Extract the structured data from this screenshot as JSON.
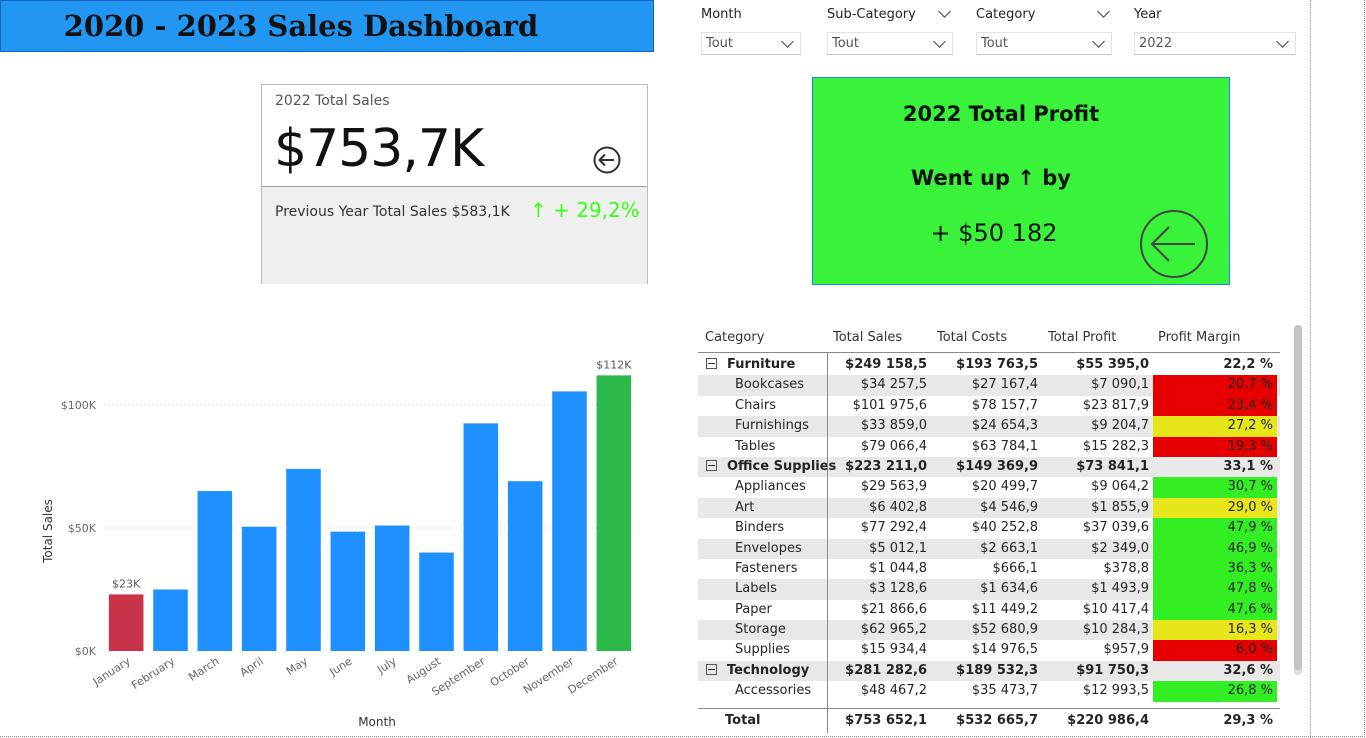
{
  "header": {
    "title": "2020 - 2023 Sales Dashboard"
  },
  "slicers": [
    {
      "label": "Month",
      "value": "Tout",
      "has_label_chevron": false
    },
    {
      "label": "Sub-Category",
      "value": "Tout",
      "has_label_chevron": true
    },
    {
      "label": "Category",
      "value": "Tout",
      "has_label_chevron": true
    },
    {
      "label": "Year",
      "value": "2022",
      "has_label_chevron": false
    }
  ],
  "sales_card": {
    "title": "2022 Total Sales",
    "value": "$753,7K",
    "previous": "Previous Year Total Sales $583,1K",
    "change": "↑ + 29,2%",
    "icon": "back-arrow-circle-icon"
  },
  "profit_card": {
    "title": "2022 Total Profit",
    "line2": "Went up ↑ by",
    "amount": "+ $50 182",
    "icon": "back-arrow-circle-icon",
    "bg_color": "#38f33a"
  },
  "chart_data": {
    "type": "bar",
    "title": "",
    "xlabel": "Month",
    "ylabel": "Total Sales",
    "categories": [
      "January",
      "February",
      "March",
      "April",
      "May",
      "June",
      "July",
      "August",
      "September",
      "October",
      "November",
      "December"
    ],
    "values": [
      23000,
      25000,
      65000,
      50500,
      74000,
      48500,
      51000,
      40000,
      92500,
      69000,
      105500,
      112000
    ],
    "ylim": [
      0,
      115000
    ],
    "yticks": [
      {
        "v": 0,
        "label": "$0K"
      },
      {
        "v": 50000,
        "label": "$50K"
      },
      {
        "v": 100000,
        "label": "$100K"
      }
    ],
    "data_labels": [
      {
        "index": 0,
        "label": "$23K"
      },
      {
        "index": 11,
        "label": "$112K"
      }
    ],
    "colors": {
      "default": "#1e90ff",
      "min": "#c8334a",
      "max": "#2db84a"
    },
    "grid": "horizontal dotted"
  },
  "matrix": {
    "columns": [
      "Category",
      "Total Sales",
      "Total Costs",
      "Total Profit",
      "Profit Margin"
    ],
    "rows": [
      {
        "type": "group",
        "cat": "Furniture",
        "sales": "$249 158,5",
        "costs": "$193 763,5",
        "profit": "$55 395,0",
        "margin": "22,2 %",
        "color": ""
      },
      {
        "type": "item",
        "cat": "Bookcases",
        "sales": "$34 257,5",
        "costs": "$27 167,4",
        "profit": "$7 090,1",
        "margin": "20,7 %",
        "color": "#e60000"
      },
      {
        "type": "item",
        "cat": "Chairs",
        "sales": "$101 975,6",
        "costs": "$78 157,7",
        "profit": "$23 817,9",
        "margin": "23,4 %",
        "color": "#e60000"
      },
      {
        "type": "item",
        "cat": "Furnishings",
        "sales": "$33 859,0",
        "costs": "$24 654,3",
        "profit": "$9 204,7",
        "margin": "27,2 %",
        "color": "#e6e61a"
      },
      {
        "type": "item",
        "cat": "Tables",
        "sales": "$79 066,4",
        "costs": "$63 784,1",
        "profit": "$15 282,3",
        "margin": "19,3 %",
        "color": "#e60000"
      },
      {
        "type": "group",
        "cat": "Office Supplies",
        "sales": "$223 211,0",
        "costs": "$149 369,9",
        "profit": "$73 841,1",
        "margin": "33,1 %",
        "color": ""
      },
      {
        "type": "item",
        "cat": "Appliances",
        "sales": "$29 563,9",
        "costs": "$20 499,7",
        "profit": "$9 064,2",
        "margin": "30,7 %",
        "color": "#33ee22"
      },
      {
        "type": "item",
        "cat": "Art",
        "sales": "$6 402,8",
        "costs": "$4 546,9",
        "profit": "$1 855,9",
        "margin": "29,0 %",
        "color": "#e6e61a"
      },
      {
        "type": "item",
        "cat": "Binders",
        "sales": "$77 292,4",
        "costs": "$40 252,8",
        "profit": "$37 039,6",
        "margin": "47,9 %",
        "color": "#33ee22"
      },
      {
        "type": "item",
        "cat": "Envelopes",
        "sales": "$5 012,1",
        "costs": "$2 663,1",
        "profit": "$2 349,0",
        "margin": "46,9 %",
        "color": "#33ee22"
      },
      {
        "type": "item",
        "cat": "Fasteners",
        "sales": "$1 044,8",
        "costs": "$666,1",
        "profit": "$378,8",
        "margin": "36,3 %",
        "color": "#33ee22"
      },
      {
        "type": "item",
        "cat": "Labels",
        "sales": "$3 128,6",
        "costs": "$1 634,6",
        "profit": "$1 493,9",
        "margin": "47,8 %",
        "color": "#33ee22"
      },
      {
        "type": "item",
        "cat": "Paper",
        "sales": "$21 866,6",
        "costs": "$11 449,2",
        "profit": "$10 417,4",
        "margin": "47,6 %",
        "color": "#33ee22"
      },
      {
        "type": "item",
        "cat": "Storage",
        "sales": "$62 965,2",
        "costs": "$52 680,9",
        "profit": "$10 284,3",
        "margin": "16,3 %",
        "color": "#e6e61a"
      },
      {
        "type": "item",
        "cat": "Supplies",
        "sales": "$15 934,4",
        "costs": "$14 976,5",
        "profit": "$957,9",
        "margin": "6,0 %",
        "color": "#e60000"
      },
      {
        "type": "group",
        "cat": "Technology",
        "sales": "$281 282,6",
        "costs": "$189 532,3",
        "profit": "$91 750,3",
        "margin": "32,6 %",
        "color": ""
      },
      {
        "type": "item",
        "cat": "Accessories",
        "sales": "$48 467,2",
        "costs": "$35 473,7",
        "profit": "$12 993,5",
        "margin": "26,8 %",
        "color": "#33ee22"
      }
    ],
    "total": {
      "cat": "Total",
      "sales": "$753 652,1",
      "costs": "$532 665,7",
      "profit": "$220 986,4",
      "margin": "29,3 %"
    }
  }
}
